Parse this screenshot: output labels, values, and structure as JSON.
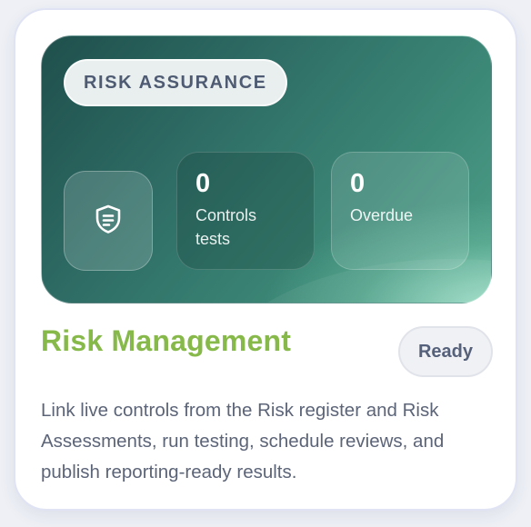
{
  "card": {
    "tag": "RISK ASSURANCE",
    "stats": [
      {
        "value": "0",
        "label": "Controls tests"
      },
      {
        "value": "0",
        "label": "Overdue"
      }
    ],
    "icon": "shield-icon",
    "title": "Risk Management",
    "status": "Ready",
    "description": "Link live controls from the Risk register and Risk Assessments, run testing, schedule reviews, and publish reporting-ready results."
  },
  "colors": {
    "title": "#86b94a",
    "hero_dark": "#1f4f4c",
    "hero_light": "#b2ecd6",
    "body_text": "#5c6478"
  }
}
